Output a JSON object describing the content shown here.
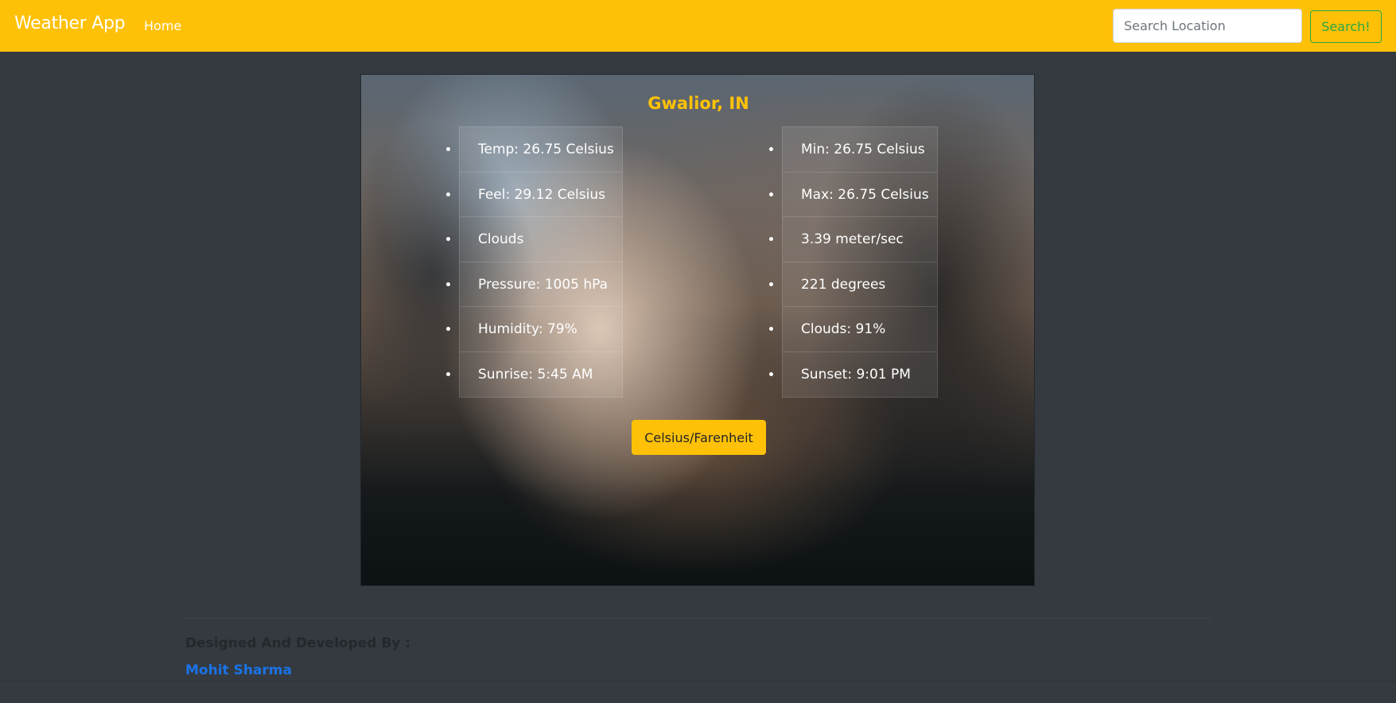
{
  "navbar": {
    "brand": "Weather App",
    "home_link": "Home",
    "search": {
      "placeholder": "Search Location",
      "value": ""
    },
    "search_button": "Search!"
  },
  "weather": {
    "location": "Gwalior, IN",
    "left_list": [
      "Temp: 26.75 Celsius",
      "Feel: 29.12 Celsius",
      "Clouds",
      "Pressure: 1005 hPa",
      "Humidity: 79%",
      "Sunrise: 5:45 AM"
    ],
    "right_list": [
      "Min: 26.75 Celsius",
      "Max: 26.75 Celsius",
      "3.39 meter/sec",
      "221 degrees",
      "Clouds: 91%",
      "Sunset: 9:01 PM"
    ],
    "unit_toggle_button": "Celsius/Farenheit"
  },
  "footer": {
    "label": "Designed And Developed By :",
    "author": "Mohit Sharma"
  },
  "colors": {
    "primary": "#ffc107",
    "success": "#28a745",
    "background": "#343a40",
    "link": "#1a73e8"
  }
}
